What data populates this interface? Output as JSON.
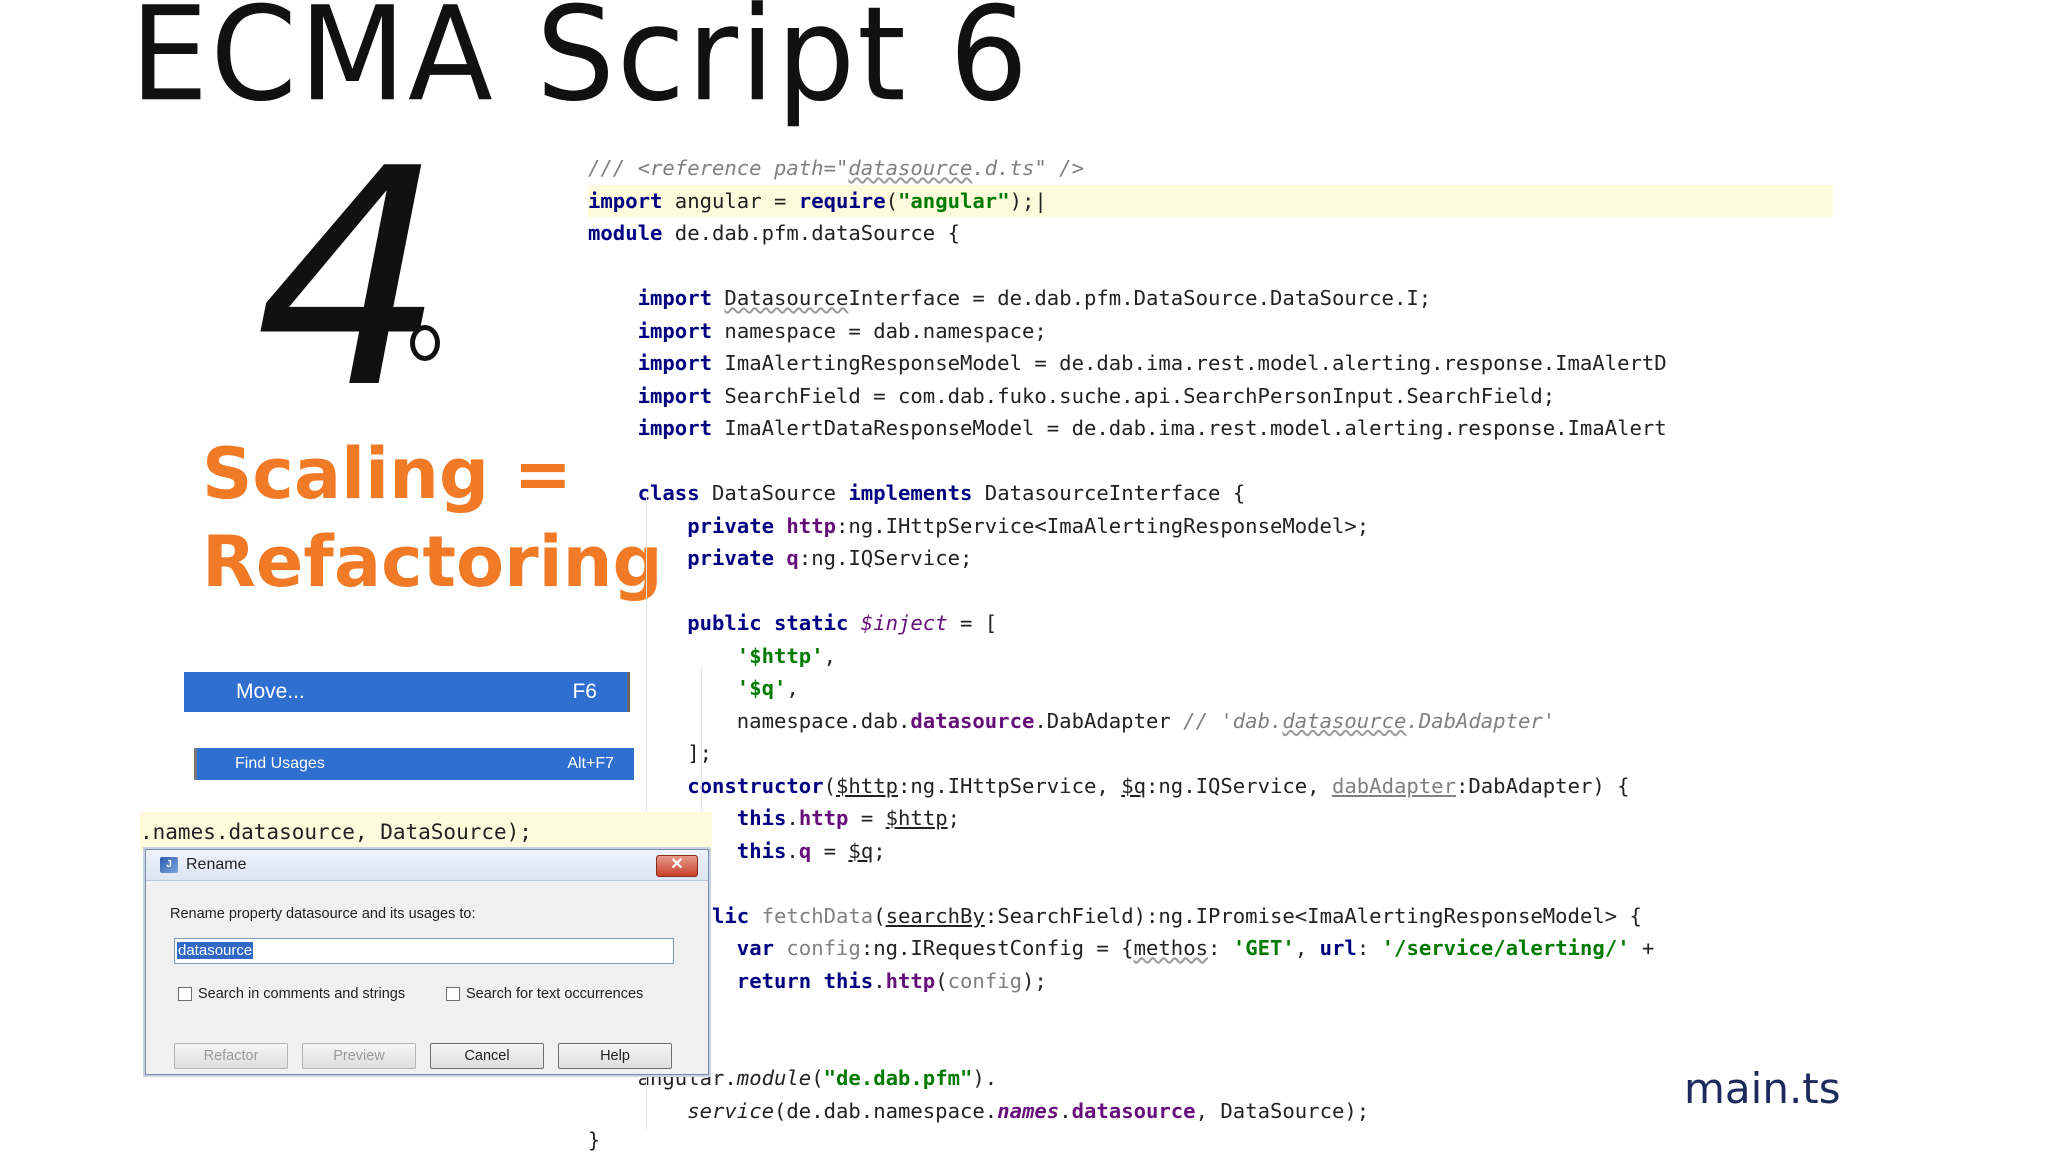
{
  "slide": {
    "title": "ECMA Script 6",
    "big_number": "4",
    "heading_line1": "Scaling =",
    "heading_line2": "Refactoring",
    "footer_label": "main.ts",
    "accent_color": "#f07a26",
    "footer_color": "#1c2a5e"
  },
  "context_menu": {
    "items": [
      {
        "label": "Move...",
        "shortcut": "F6"
      },
      {
        "label": "Find Usages",
        "shortcut": "Alt+F7"
      }
    ],
    "highlight_color": "#2f6fd0"
  },
  "snippet": {
    "text": ".names.datasource, DataSource);"
  },
  "rename_dialog": {
    "title": "Rename",
    "prompt": "Rename property datasource and its usages to:",
    "input_value": "datasource",
    "checkbox_comments": "Search in comments and strings",
    "checkbox_text": "Search for text occurrences",
    "btn_refactor": "Refactor",
    "btn_preview": "Preview",
    "btn_cancel": "Cancel",
    "btn_help": "Help"
  },
  "code": {
    "closing_brace": "}"
  }
}
